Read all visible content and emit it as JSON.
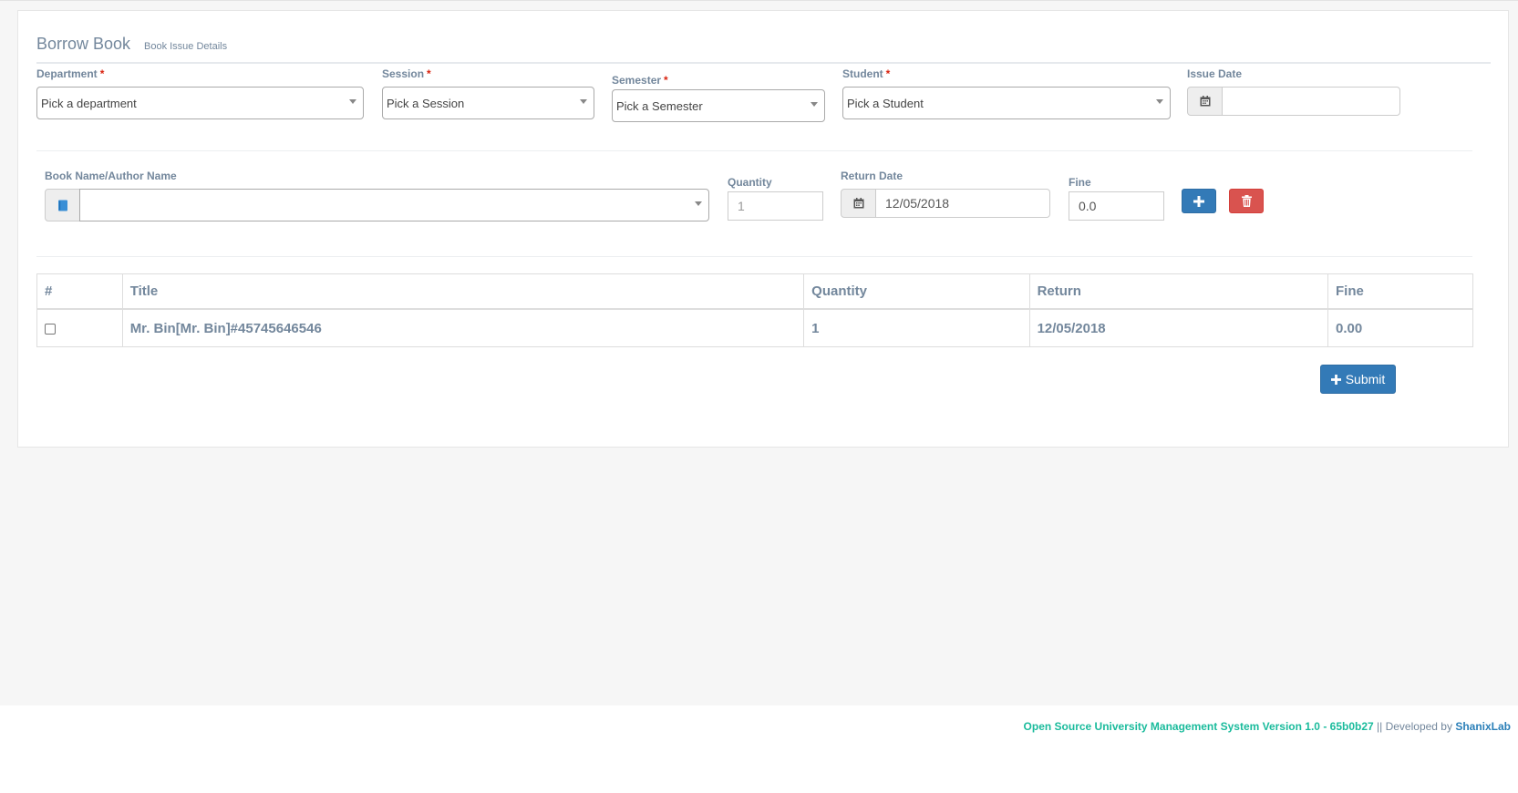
{
  "panel": {
    "title": "Borrow Book",
    "subtitle": "Book Issue Details"
  },
  "form": {
    "department": {
      "label": "Department",
      "required": "*",
      "value": "Pick a department"
    },
    "session": {
      "label": "Session",
      "required": "*",
      "value": "Pick a Session"
    },
    "semester": {
      "label": "Semester",
      "required": "*",
      "value": "Pick a Semester"
    },
    "student": {
      "label": "Student",
      "required": "*",
      "value": "Pick a Student"
    },
    "issue_date": {
      "label": "Issue Date",
      "value": ""
    },
    "book": {
      "label": "Book Name/Author Name",
      "value": ""
    },
    "quantity": {
      "label": "Quantity",
      "placeholder": "1"
    },
    "return_date": {
      "label": "Return Date",
      "value": "12/05/2018"
    },
    "fine": {
      "label": "Fine",
      "value": "0.0"
    }
  },
  "table": {
    "headers": [
      "#",
      "Title",
      "Quantity",
      "Return",
      "Fine"
    ],
    "rows": [
      {
        "checked": false,
        "title": "Mr. Bin[Mr. Bin]#45745646546",
        "quantity": "1",
        "return": "12/05/2018",
        "fine": "0.00"
      }
    ]
  },
  "submit_label": "Submit",
  "footer": {
    "system": "Open Source University Management System Version 1.0 - 65b0b27",
    "separator": " || Developed by ",
    "developer": "ShanixLab"
  },
  "colors": {
    "primary": "#337ab7",
    "danger": "#d9534f",
    "label": "#73879C",
    "accent": "#1ABB9C"
  },
  "icons": {
    "calendar": "calendar-icon",
    "book": "book-icon",
    "plus": "plus-icon",
    "trash": "trash-icon"
  }
}
